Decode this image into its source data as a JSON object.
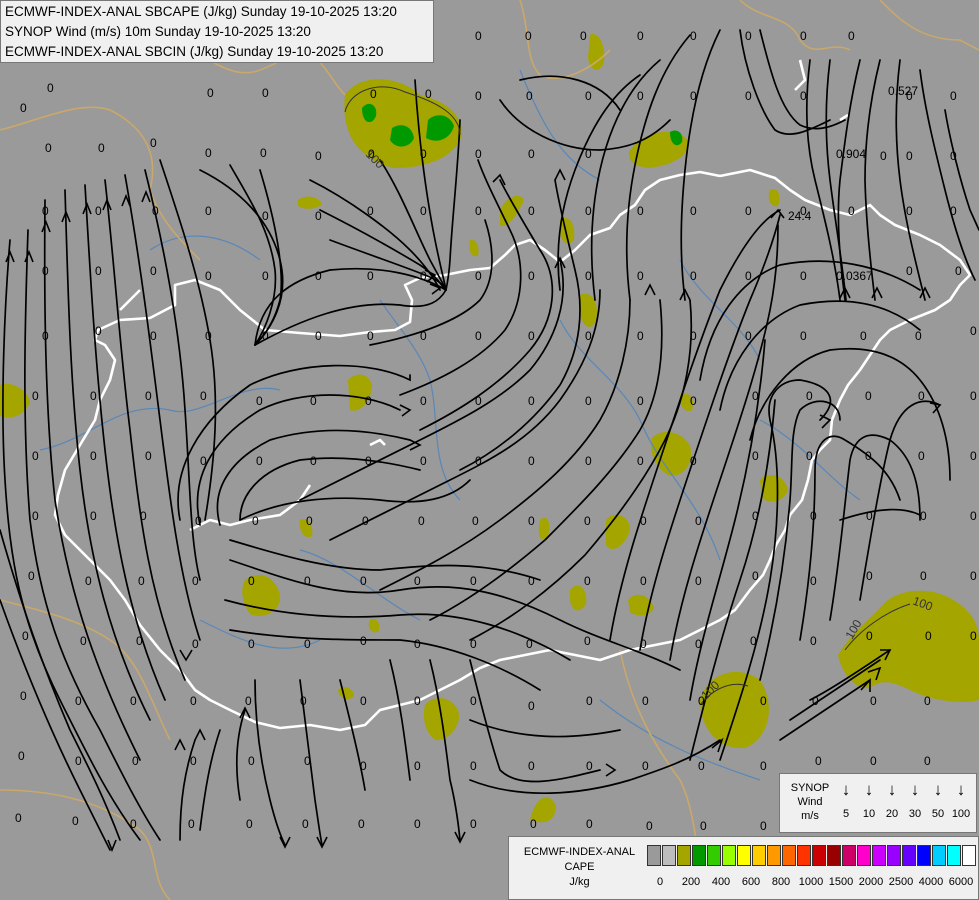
{
  "header": {
    "line1": "ECMWF-INDEX-ANAL SBCAPE (J/kg) Sunday 19-10-2025 13:20",
    "line2": "SYNOP Wind (m/s) 10m Sunday 19-10-2025 13:20",
    "line3": "ECMWF-INDEX-ANAL SBCIN (J/kg) Sunday 19-10-2025 13:20"
  },
  "wind_legend": {
    "title": "SYNOP\nWind\nm/s",
    "speeds": [
      "5",
      "10",
      "20",
      "30",
      "50",
      "100"
    ]
  },
  "cape_legend": {
    "title": "ECMWF-INDEX-ANAL\nCAPE\nJ/kg",
    "colors": [
      "#9a9a9a",
      "#bdbdbd",
      "#a5a500",
      "#009900",
      "#33cc00",
      "#99ff00",
      "#ffff00",
      "#ffcc00",
      "#ff9900",
      "#ff6600",
      "#ff3300",
      "#cc0000",
      "#990000",
      "#cc0066",
      "#ff00cc",
      "#cc00ff",
      "#9900ff",
      "#6600ff",
      "#0000ff",
      "#00ccff",
      "#00ffff",
      "#ffffff"
    ],
    "ticks": [
      "0",
      "200",
      "400",
      "600",
      "800",
      "1000",
      "1500",
      "2000",
      "2500",
      "4000",
      "6000"
    ]
  },
  "map_labels": {
    "cin_zero": "0",
    "contour_100": "100",
    "val_24_4": "24.4",
    "val_0_904": "0.904",
    "val_0_0367": "0.0367",
    "val_0_527": "0.527"
  },
  "colors": {
    "background": "#9a9a9a",
    "cape_200": "#a5a500",
    "cape_400": "#009900",
    "border": "#ffffff",
    "rivers": "#5a87b8",
    "region_lines": "#c9a86a",
    "streamlines": "#000000"
  }
}
